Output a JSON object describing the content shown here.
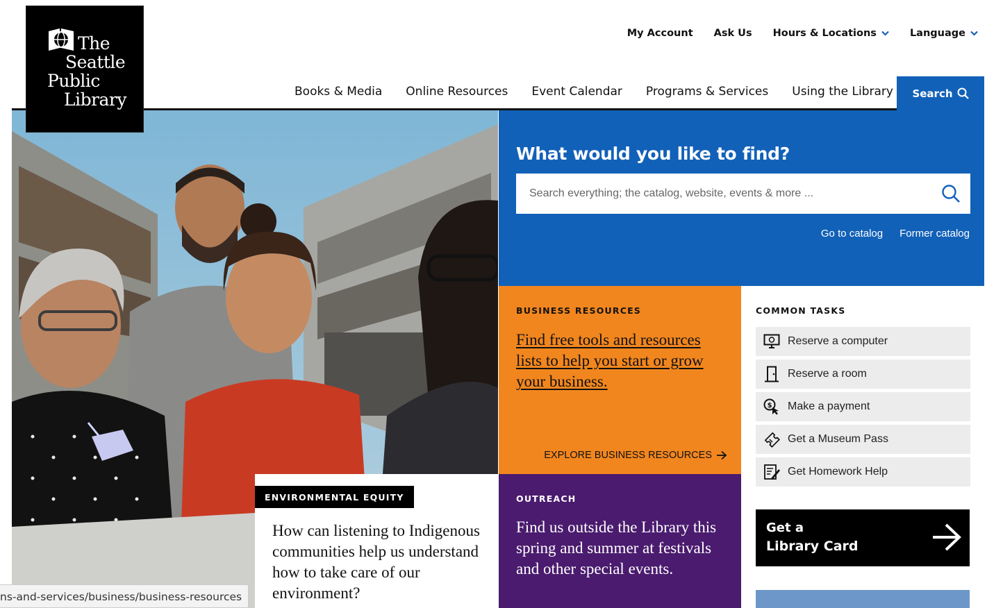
{
  "logo": {
    "line1": "The",
    "line2": "Seattle",
    "line3": "Public",
    "line4": "Library"
  },
  "utility_nav": [
    {
      "label": "My Account",
      "has_dropdown": false
    },
    {
      "label": "Ask Us",
      "has_dropdown": false
    },
    {
      "label": "Hours & Locations",
      "has_dropdown": true
    },
    {
      "label": "Language",
      "has_dropdown": true
    }
  ],
  "main_nav": [
    "Books & Media",
    "Online Resources",
    "Event Calendar",
    "Programs & Services",
    "Using the Library"
  ],
  "search_tab": {
    "label": "Search",
    "icon": "search-icon"
  },
  "find": {
    "heading": "What would you like to find?",
    "placeholder": "Search everything; the catalog, website, events & more ...",
    "catalog_link": "Go to catalog",
    "former_catalog_link": "Former catalog"
  },
  "business": {
    "kicker": "BUSINESS RESOURCES",
    "lead": "Find free tools and resources lists to help you start or grow your business.",
    "explore": "EXPLORE BUSINESS RESOURCES"
  },
  "environmental": {
    "tag": "ENVIRONMENTAL EQUITY",
    "lead": "How can listening to Indigenous communities help us understand how to take care of our environment?"
  },
  "outreach": {
    "kicker": "OUTREACH",
    "lead": "Find us outside the Library this spring and summer at festivals and other special events."
  },
  "common_tasks": {
    "kicker": "COMMON TASKS",
    "items": [
      {
        "label": "Reserve a computer",
        "icon": "computer-icon"
      },
      {
        "label": "Reserve a room",
        "icon": "door-icon"
      },
      {
        "label": "Make a payment",
        "icon": "payment-icon"
      },
      {
        "label": "Get a Museum Pass",
        "icon": "ticket-icon"
      },
      {
        "label": "Get Homework Help",
        "icon": "homework-icon"
      }
    ]
  },
  "library_card": {
    "line1": "Get a",
    "line2": "Library Card"
  },
  "colors": {
    "blue": "#1261b8",
    "orange": "#f2861e",
    "purple": "#4a1b6e",
    "black": "#000000"
  },
  "status_url": "ns-and-services/business/business-resources"
}
